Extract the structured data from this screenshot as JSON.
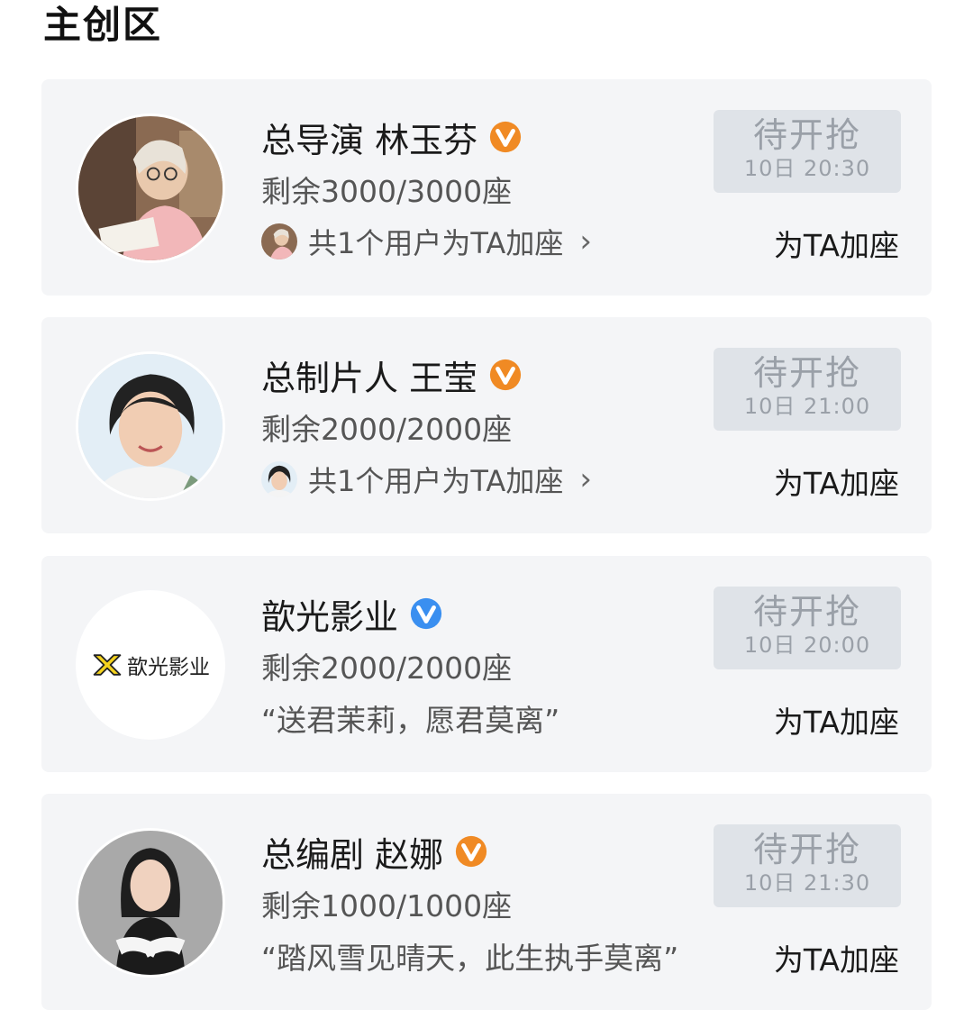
{
  "section": {
    "title": "主创区"
  },
  "cards": [
    {
      "name": "总导演 林玉芬",
      "verify_color": "#f08a24",
      "verify_icon": "v-badge-orange",
      "seats": "剩余3000/3000座",
      "sub_text": "共1个用户为TA加座",
      "chevron": "›",
      "grab_title": "待开抢",
      "grab_time": "10日 20:30",
      "add_label": "为TA加座"
    },
    {
      "name": "总制片人 王莹",
      "verify_color": "#f08a24",
      "verify_icon": "v-badge-orange",
      "seats": "剩余2000/2000座",
      "sub_text": "共1个用户为TA加座",
      "chevron": "›",
      "grab_title": "待开抢",
      "grab_time": "10日 21:00",
      "add_label": "为TA加座"
    },
    {
      "name": "歆光影业",
      "verify_color": "#3a8ff0",
      "verify_icon": "v-badge-blue",
      "logo_text": "歆光影业",
      "seats": "剩余2000/2000座",
      "quote": "“送君茉莉，愿君莫离”",
      "grab_title": "待开抢",
      "grab_time": "10日 20:00",
      "add_label": "为TA加座"
    },
    {
      "name": "总编剧 赵娜",
      "verify_color": "#f08a24",
      "verify_icon": "v-badge-orange",
      "seats": "剩余1000/1000座",
      "quote": "“踏风雪见晴天，此生执手莫离”",
      "grab_title": "待开抢",
      "grab_time": "10日 21:30",
      "add_label": "为TA加座"
    }
  ]
}
